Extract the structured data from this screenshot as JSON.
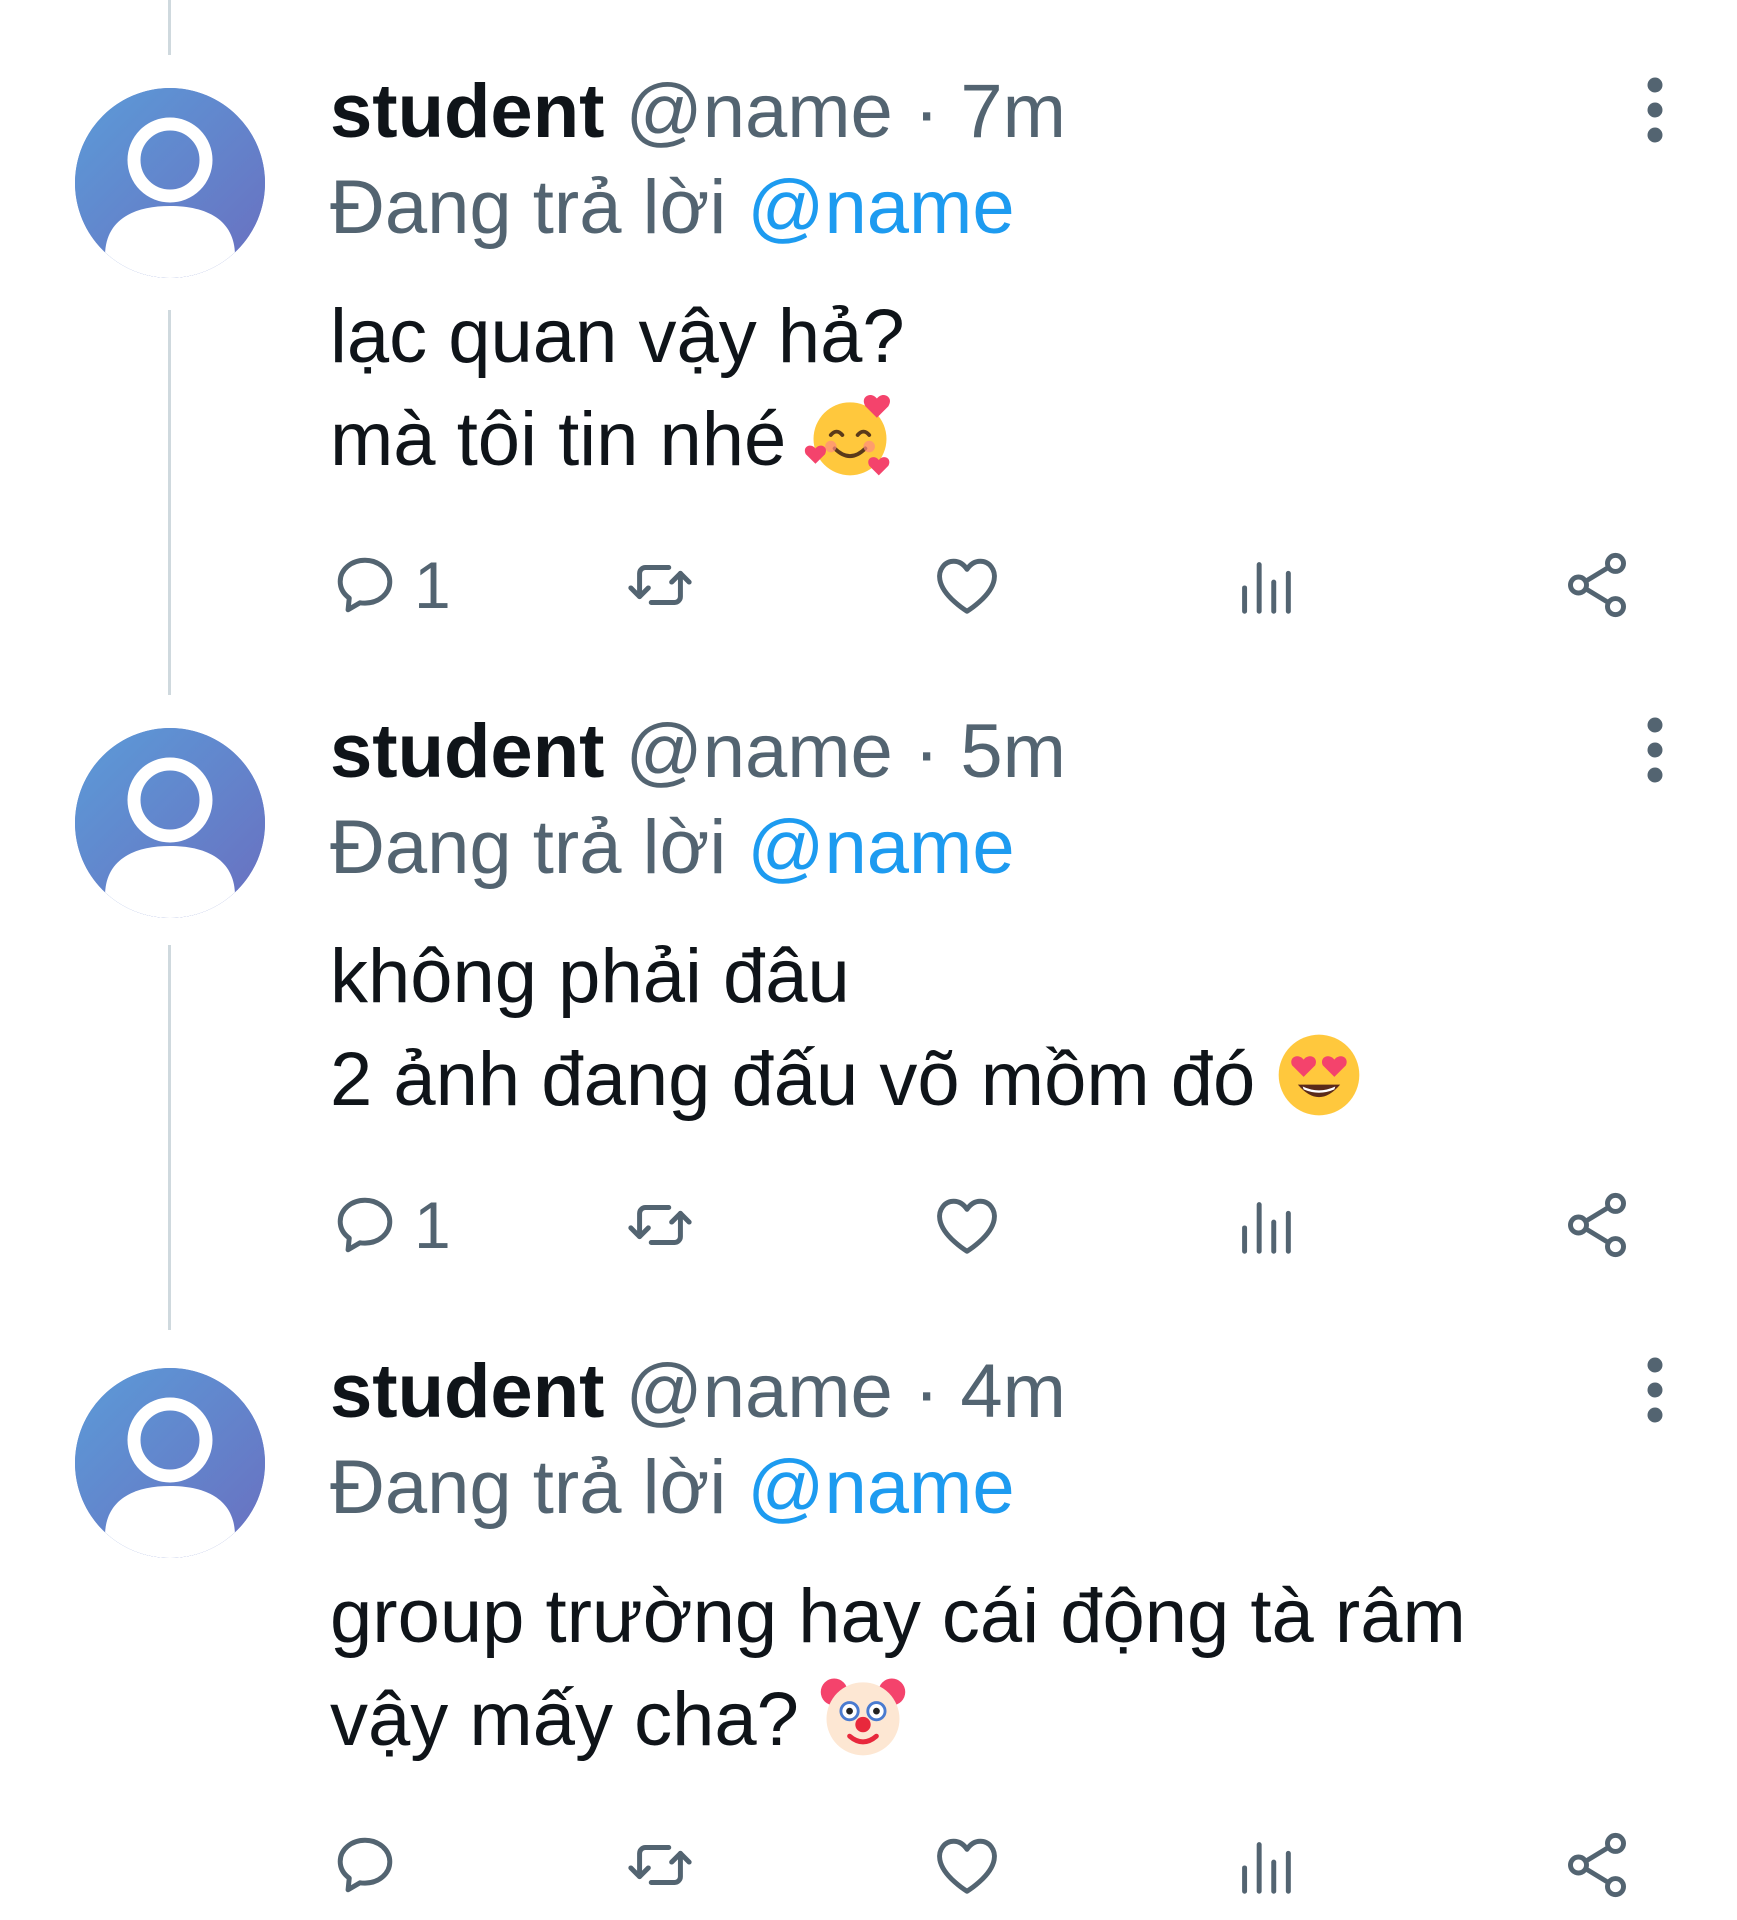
{
  "colors": {
    "accent": "#1d9bf0",
    "secondary_text": "#536471",
    "primary_text": "#0f1419",
    "avatar": "#6a86c9",
    "thread_line": "#cfd9de"
  },
  "tweets": [
    {
      "name": "student",
      "handle": "@name",
      "separator": "·",
      "time": "7m",
      "reply_prefix": "Đang trả lời",
      "reply_mention": "@name",
      "body_line1": "lạc quan vậy hả?",
      "body_line2": "mà tôi tin nhé",
      "emoji": "smiling-face-with-hearts",
      "reply_count": "1"
    },
    {
      "name": "student",
      "handle": "@name",
      "separator": "·",
      "time": "5m",
      "reply_prefix": "Đang trả lời",
      "reply_mention": "@name",
      "body_line1": "không phải đâu",
      "body_line2": "2 ảnh đang đấu võ mồm đó",
      "emoji": "smiling-face-with-heart-eyes",
      "reply_count": "1"
    },
    {
      "name": "student",
      "handle": "@name",
      "separator": "·",
      "time": "4m",
      "reply_prefix": "Đang trả lời",
      "reply_mention": "@name",
      "body_line1": "group trường hay cái động tà râm",
      "body_line2": "vậy mấy cha?",
      "emoji": "clown-face",
      "reply_count": ""
    }
  ],
  "action_icons": [
    "reply-icon",
    "retweet-icon",
    "like-icon",
    "views-icon",
    "share-icon"
  ]
}
